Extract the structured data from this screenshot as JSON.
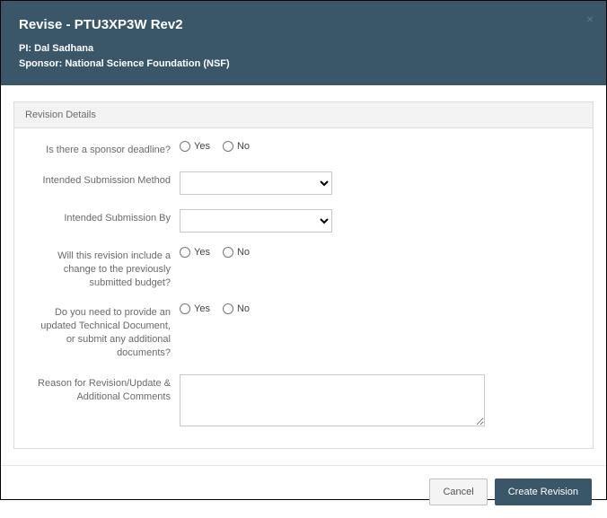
{
  "header": {
    "title": "Revise - PTU3XP3W Rev2",
    "pi_label": "PI:",
    "pi_name": "Dal Sadhana",
    "sponsor_label": "Sponsor:",
    "sponsor_name": "National Science Foundation (NSF)"
  },
  "panel": {
    "title": "Revision Details",
    "fields": {
      "sponsor_deadline": {
        "label": "Is there a sponsor deadline?",
        "yes": "Yes",
        "no": "No"
      },
      "submission_method": {
        "label": "Intended Submission Method",
        "selected": ""
      },
      "submission_by": {
        "label": "Intended Submission By",
        "selected": ""
      },
      "budget_change": {
        "label": "Will this revision include a change to the previously submitted budget?",
        "yes": "Yes",
        "no": "No"
      },
      "tech_doc": {
        "label": "Do you need to provide an updated Technical Document, or submit any additional documents?",
        "yes": "Yes",
        "no": "No"
      },
      "reason": {
        "label": "Reason for Revision/Update & Additional Comments",
        "value": ""
      }
    }
  },
  "footer": {
    "cancel": "Cancel",
    "create": "Create Revision"
  }
}
